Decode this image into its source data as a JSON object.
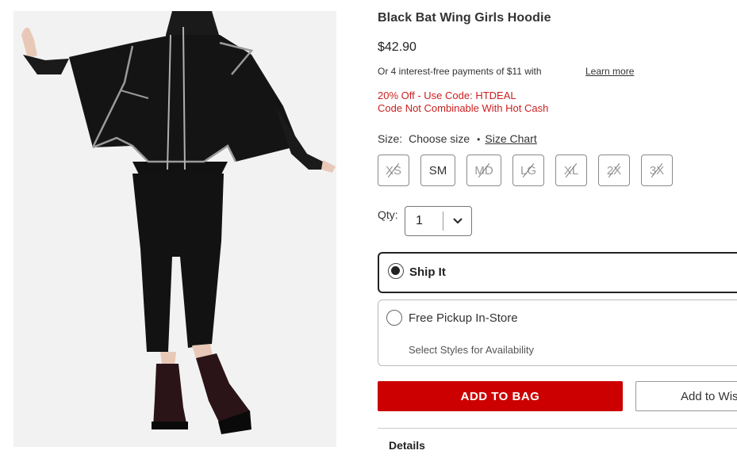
{
  "product": {
    "image_alt": "Black Bat Wing Girls Hoodie model photo",
    "title": "Black Bat Wing Girls Hoodie",
    "price": "$42.90",
    "installments_text": "Or 4 interest-free payments of $11 with",
    "learn_more": "Learn more",
    "promo_line1": "20% Off - Use Code: HTDEAL",
    "promo_line2": "Code Not Combinable With Hot Cash"
  },
  "size": {
    "label": "Size:",
    "choose": "Choose size",
    "separator": "•",
    "chart_link": "Size Chart",
    "options": [
      {
        "label": "XS",
        "available": false
      },
      {
        "label": "SM",
        "available": true
      },
      {
        "label": "MD",
        "available": false
      },
      {
        "label": "LG",
        "available": false
      },
      {
        "label": "XL",
        "available": false
      },
      {
        "label": "2X",
        "available": false
      },
      {
        "label": "3X",
        "available": false
      }
    ]
  },
  "quantity": {
    "label": "Qty:",
    "value": "1"
  },
  "fulfillment": {
    "ship_label": "Ship It",
    "pickup_label": "Free Pickup In-Store",
    "pickup_sub": "Select Styles for Availability"
  },
  "actions": {
    "add_to_bag": "ADD TO BAG",
    "add_to_wishlist": "Add to Wishlist"
  },
  "details_label": "Details",
  "colors": {
    "accent_red": "#cc0000",
    "promo_red": "#cc1f1f"
  }
}
